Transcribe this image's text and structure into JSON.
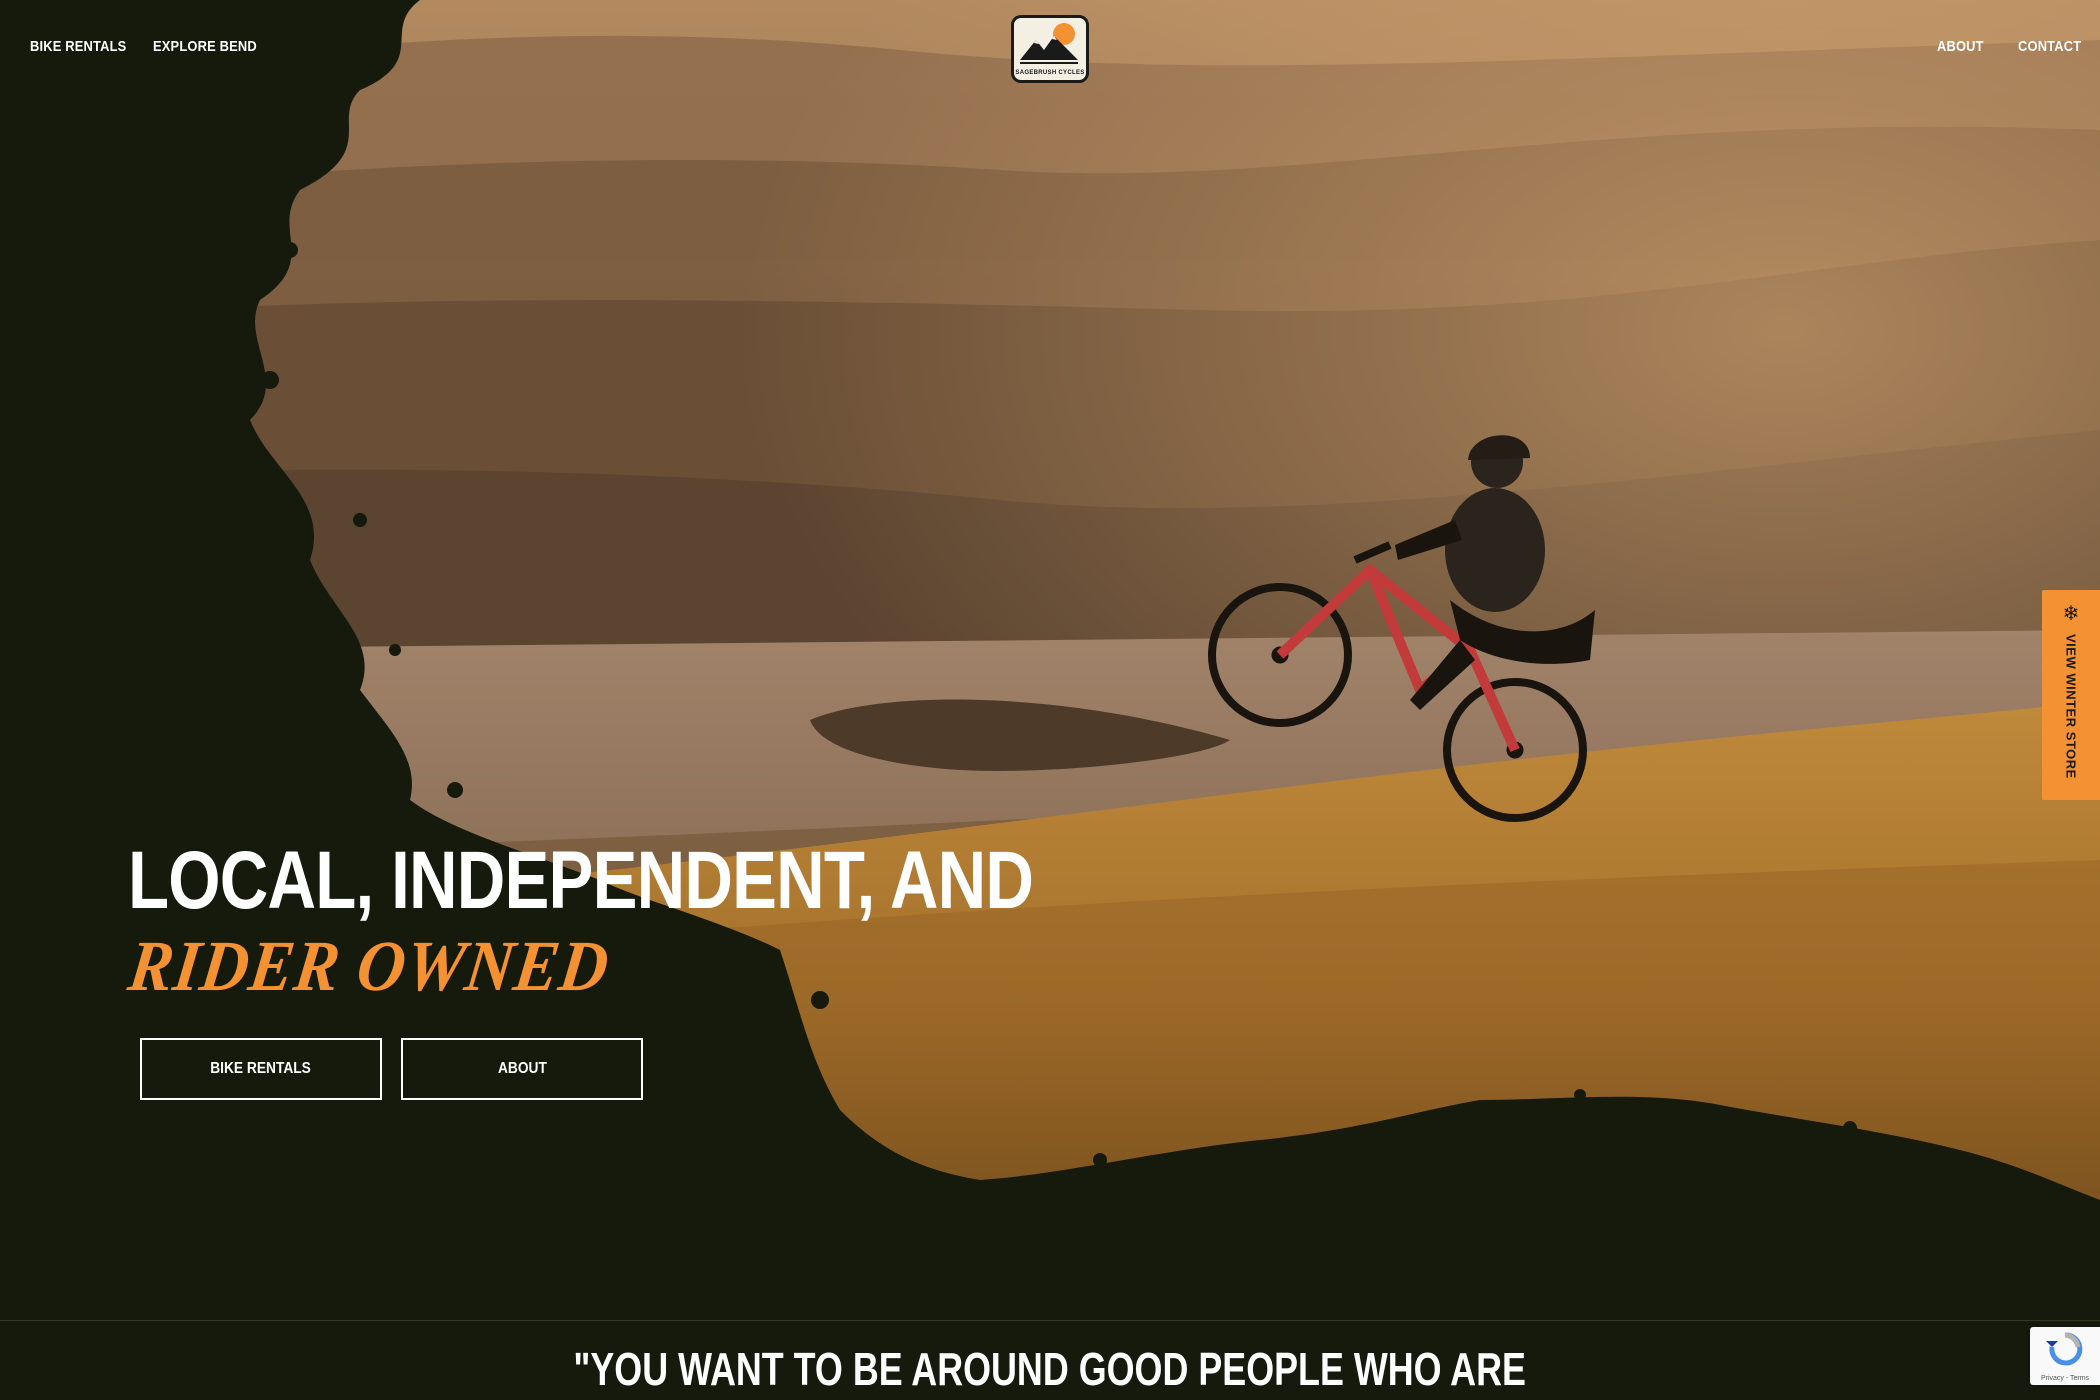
{
  "nav": {
    "left": [
      {
        "label": "BIKE RENTALS"
      },
      {
        "label": "EXPLORE BEND"
      }
    ],
    "right": [
      {
        "label": "ABOUT"
      },
      {
        "label": "CONTACT"
      }
    ],
    "logo_text": "SAGEBRUSH CYCLES"
  },
  "hero": {
    "title_line1": "LOCAL, INDEPENDENT, AND",
    "title_line2": "RIDER OWNED",
    "buttons": [
      {
        "label": "BIKE RENTALS"
      },
      {
        "label": "ABOUT"
      }
    ]
  },
  "side_tab": {
    "icon": "snowflake-icon",
    "label": "VIEW WINTER STORE"
  },
  "quote": {
    "text": "\"YOU WANT TO BE AROUND GOOD PEOPLE WHO ARE"
  },
  "recaptcha": {
    "footer": "Privacy - Terms"
  },
  "colors": {
    "background": "#151a0c",
    "accent": "#f39133",
    "text": "#ffffff"
  }
}
